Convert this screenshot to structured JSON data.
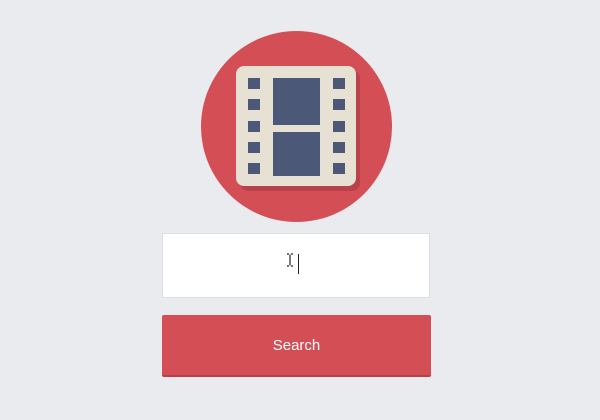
{
  "app": {
    "logo_icon": "film-strip-icon"
  },
  "search": {
    "value": "",
    "placeholder": ""
  },
  "button": {
    "label": "Search"
  },
  "colors": {
    "background": "#e9ebee",
    "accent": "#d44e55",
    "film_frame": "#e6e1d2",
    "film_cell": "#4b5878"
  }
}
